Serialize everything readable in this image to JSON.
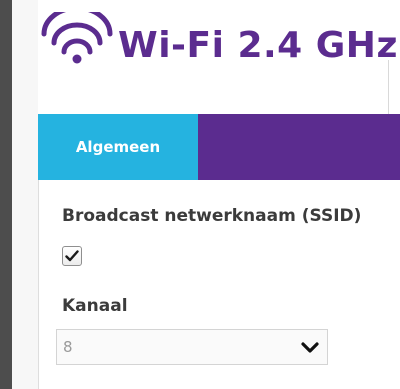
{
  "header": {
    "title": "Wi-Fi 2.4 GHz",
    "icon": "wifi-icon",
    "color": "#5b2c8f"
  },
  "tabs": [
    {
      "label": "Algemeen",
      "active": true,
      "color": "#25b3e0"
    }
  ],
  "tab_bar_color": "#5b2c8f",
  "form": {
    "ssid_broadcast": {
      "label": "Broadcast netwerknaam (SSID)",
      "checked": true,
      "icon": "checkmark-icon"
    },
    "channel": {
      "label": "Kanaal",
      "value": "8",
      "icon": "chevron-down-icon"
    }
  }
}
